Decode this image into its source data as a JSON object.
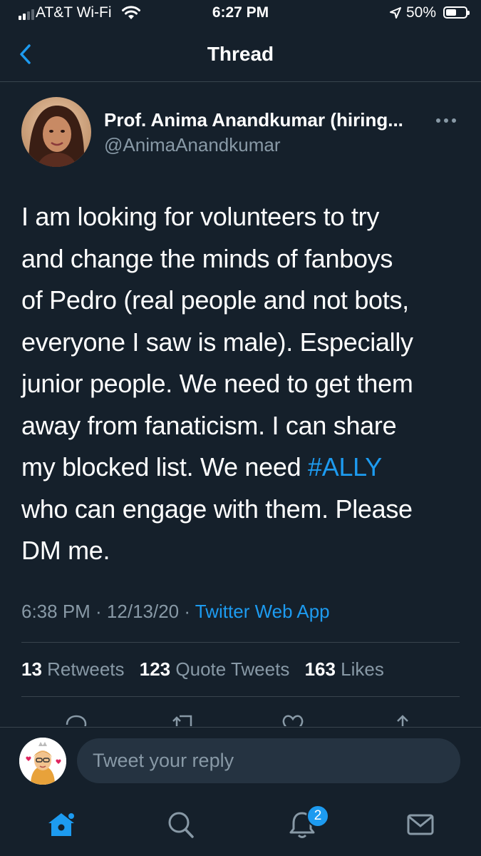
{
  "status_bar": {
    "carrier": "AT&T Wi-Fi",
    "time": "6:27 PM",
    "battery": "50%",
    "battery_level": 0.5,
    "icons": [
      "signal-icon",
      "wifi-icon",
      "location-icon",
      "battery-icon"
    ]
  },
  "header": {
    "title": "Thread",
    "back_icon": "chevron-left-icon"
  },
  "tweet": {
    "author_name": "Prof. Anima Anandkumar (hiring...",
    "author_handle": "@AnimaAnandkumar",
    "more_icon": "more-icon",
    "lines": [
      "I am looking for volunteers to try",
      "and change the minds of fanboys",
      "of Pedro (real people and not bots,",
      "everyone I saw is male). Especially",
      "junior people. We need to get them",
      "away from fanaticism. I can share",
      "my blocked list. We need ",
      "who can engage with them. Please",
      "DM me."
    ],
    "hashtag": "#ALLY",
    "timestamp": "6:38 PM · 12/13/20 · ",
    "source": "Twitter Web App",
    "retweets_count": "13",
    "retweets_label": " Retweets",
    "quote_count": "123",
    "quote_label": " Quote Tweets",
    "likes_count": "163",
    "likes_label": " Likes",
    "action_icons": [
      "reply-icon",
      "retweet-icon",
      "like-icon",
      "share-icon"
    ]
  },
  "reply": {
    "placeholder": "Tweet your reply"
  },
  "tab_bar": {
    "notifications_badge": "2",
    "icons": [
      "home-icon",
      "search-icon",
      "notifications-icon",
      "messages-icon"
    ]
  },
  "colors": {
    "background": "#15202b",
    "accent": "#1d9bf0",
    "secondary_text": "#8899a6",
    "divider": "#38444d"
  }
}
